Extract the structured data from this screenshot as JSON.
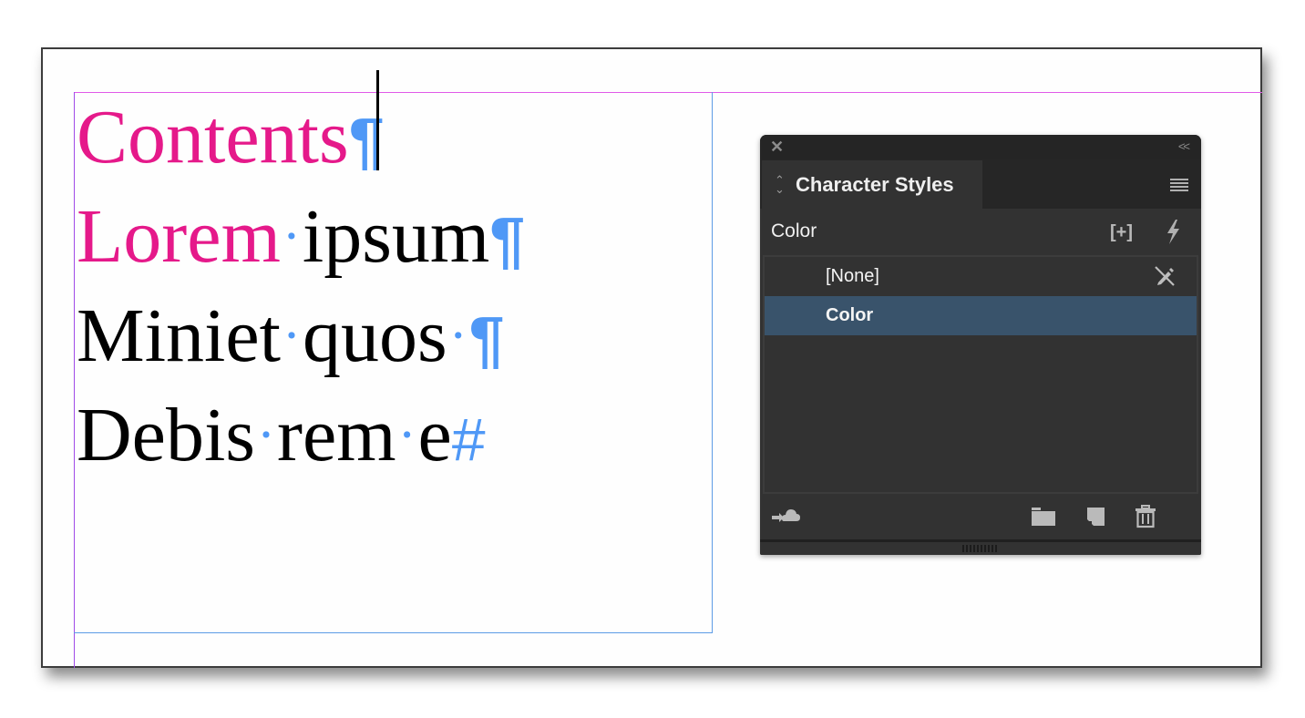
{
  "document": {
    "lines": [
      {
        "words": [
          {
            "text": "Contents",
            "style": "Color"
          }
        ],
        "end_mark": "¶"
      },
      {
        "words": [
          {
            "text": "Lorem",
            "style": "Color"
          },
          {
            "text": "ipsum",
            "style": "[None]"
          }
        ],
        "end_mark": "¶"
      },
      {
        "words": [
          {
            "text": "Miniet",
            "style": "[None]"
          },
          {
            "text": "quos",
            "style": "[None]"
          }
        ],
        "end_mark": "¶",
        "trailing_space": true
      },
      {
        "words": [
          {
            "text": "Debis",
            "style": "[None]"
          },
          {
            "text": "rem",
            "style": "[None]"
          },
          {
            "text": "e",
            "style": "[None]"
          }
        ],
        "end_mark": "#"
      }
    ],
    "space_marker": "·",
    "colors": {
      "style_color": "#e5198a",
      "hidden_chars": "#4f98f6",
      "margin_guide": "#e05ae8",
      "frame_edge": "#5d9ce6"
    }
  },
  "panel": {
    "close_icon": "close-icon",
    "collapse_label": "<<",
    "tab_label": "Character Styles",
    "group_label": "Color",
    "new_group_icon": "[+]",
    "items": [
      {
        "label": "[None]",
        "selected": false
      },
      {
        "label": "Color",
        "selected": true
      }
    ],
    "bottom_icons": [
      "cc-library-icon",
      "folder-icon",
      "new-style-icon",
      "trash-icon"
    ],
    "selection_color": "#39536b"
  }
}
